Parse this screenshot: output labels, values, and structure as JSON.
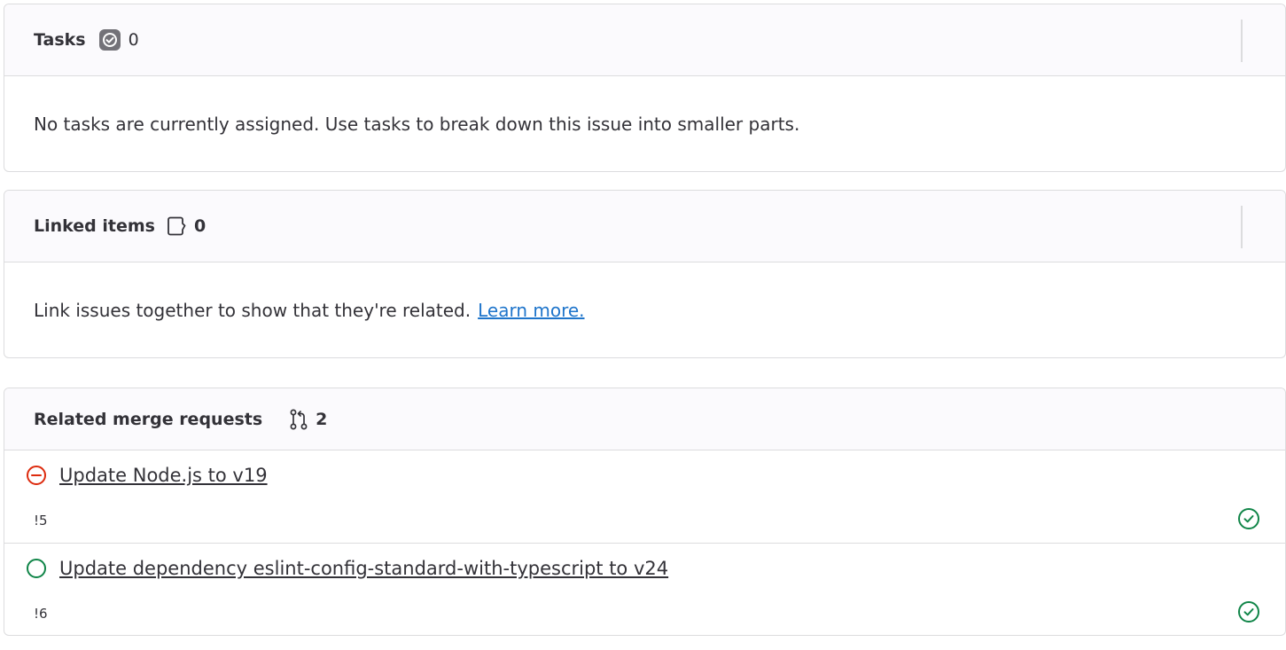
{
  "tasks": {
    "title": "Tasks",
    "count": "0",
    "empty_text": "No tasks are currently assigned. Use tasks to break down this issue into smaller parts."
  },
  "linked_items": {
    "title": "Linked items",
    "count": "0",
    "body_text": "Link issues together to show that they're related.",
    "learn_more": "Learn more."
  },
  "merge_requests": {
    "title": "Related merge requests",
    "count": "2",
    "items": [
      {
        "title": "Update Node.js to v19",
        "ref": "!5",
        "state": "closed",
        "pipeline": "passed"
      },
      {
        "title": "Update dependency eslint-config-standard-with-typescript to v24",
        "ref": "!6",
        "state": "open",
        "pipeline": "passed"
      }
    ]
  },
  "colors": {
    "text": "#333238",
    "link": "#1f75cb",
    "closed_red": "#dd2b0e",
    "success_green": "#108548",
    "border": "#dcdcde"
  },
  "icons": {
    "tasks": "task-done-icon",
    "linked": "issue-link-icon",
    "mr": "merge-request-icon",
    "closed": "status-closed-icon",
    "open": "status-open-icon",
    "pipeline": "status-success-icon"
  }
}
